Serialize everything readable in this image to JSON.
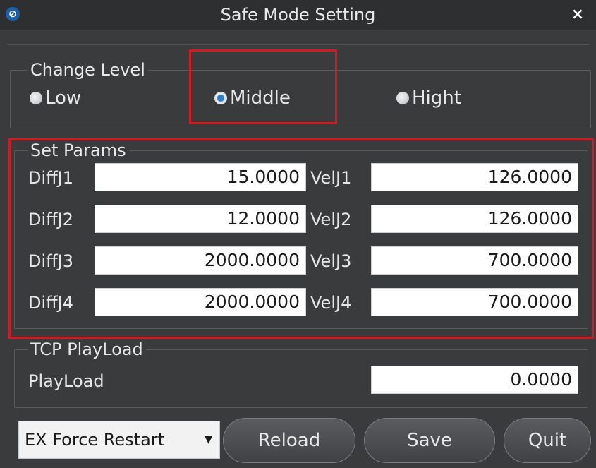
{
  "window": {
    "title": "Safe Mode Setting",
    "close_glyph": "×"
  },
  "change_level": {
    "legend": "Change Level",
    "options": [
      {
        "label": "Low",
        "checked": false
      },
      {
        "label": "Middle",
        "checked": true
      },
      {
        "label": "Hight",
        "checked": false
      }
    ]
  },
  "set_params": {
    "legend": "Set Params",
    "rows": [
      {
        "diff_label": "DiffJ1",
        "diff_value": "15.0000",
        "vel_label": "VelJ1",
        "vel_value": "126.0000"
      },
      {
        "diff_label": "DiffJ2",
        "diff_value": "12.0000",
        "vel_label": "VelJ2",
        "vel_value": "126.0000"
      },
      {
        "diff_label": "DiffJ3",
        "diff_value": "2000.0000",
        "vel_label": "VelJ3",
        "vel_value": "700.0000"
      },
      {
        "diff_label": "DiffJ4",
        "diff_value": "2000.0000",
        "vel_label": "VelJ4",
        "vel_value": "700.0000"
      }
    ]
  },
  "tcp_payload": {
    "legend": "TCP PlayLoad",
    "label": "PlayLoad",
    "value": "0.0000"
  },
  "footer": {
    "mode_select": "EX Force Restart",
    "reload_label": "Reload",
    "save_label": "Save",
    "quit_label": "Quit"
  },
  "icons": {
    "app": "app-logo-icon",
    "close": "close-icon",
    "dropdown": "chevron-down-icon"
  },
  "colors": {
    "background": "#3a3b3d",
    "highlight_border": "#d11b22",
    "radio_checked": "#2e7fc5"
  }
}
